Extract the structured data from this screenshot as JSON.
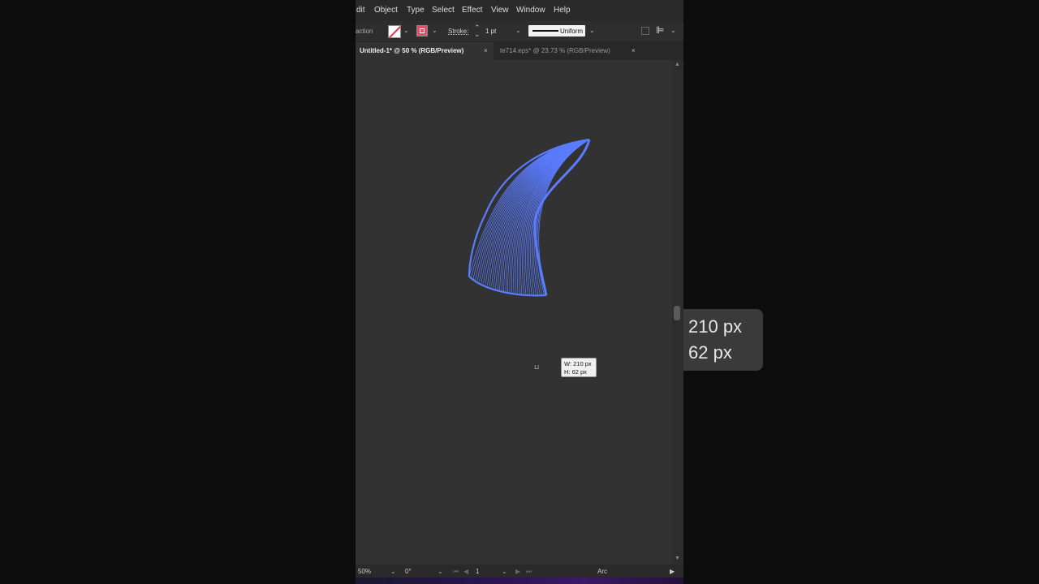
{
  "menubar": {
    "items": [
      "dit",
      "Object",
      "Type",
      "Select",
      "Effect",
      "View",
      "Window",
      "Help"
    ]
  },
  "controlbar": {
    "tool_label": "action",
    "stroke_label": "Stroke:",
    "stroke_weight": "1 pt",
    "stroke_profile": "Uniform",
    "fill_icon": "fill-none-swatch",
    "stroke_color": "#e05268"
  },
  "tabs": [
    {
      "label": "Untitled-1* @ 50 % (RGB/Preview)",
      "close": "×",
      "active": true
    },
    {
      "label": "te714.eps* @ 23.73 % (RGB/Preview)",
      "close": "×",
      "active": false
    }
  ],
  "canvas": {
    "artwork_color": "#5a7cff",
    "dimension_tooltip": {
      "width": "W: 210 px",
      "height": "H: 62 px"
    }
  },
  "zoom_callout": {
    "width": "210 px",
    "height": "62 px"
  },
  "statusbar": {
    "zoom": "50%",
    "rotation": "0°",
    "artboard": "1",
    "tool": "Arc"
  }
}
